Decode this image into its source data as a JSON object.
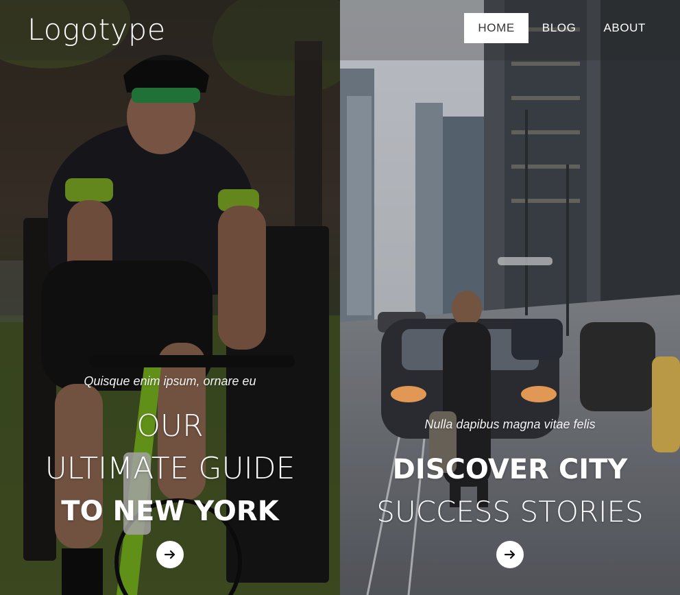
{
  "header": {
    "logo": "Logotype",
    "nav": [
      {
        "label": "HOME",
        "active": true
      },
      {
        "label": "BLOG",
        "active": false
      },
      {
        "label": "ABOUT",
        "active": false
      }
    ]
  },
  "stories": [
    {
      "tagline": "Quisque enim ipsum, ornare eu",
      "title_lines": [
        "OUR",
        "ULTIMATE GUIDE",
        "TO NEW YORK"
      ],
      "arrow_icon": "arrow-right-icon"
    },
    {
      "tagline": "Nulla dapibus magna vitae felis",
      "title_lines": [
        "DISCOVER CITY",
        "SUCCESS STORIES"
      ],
      "arrow_icon": "arrow-right-icon"
    }
  ],
  "colors": {
    "nav_active_bg": "#ffffff",
    "nav_active_text": "#333333",
    "text": "#ffffff"
  }
}
